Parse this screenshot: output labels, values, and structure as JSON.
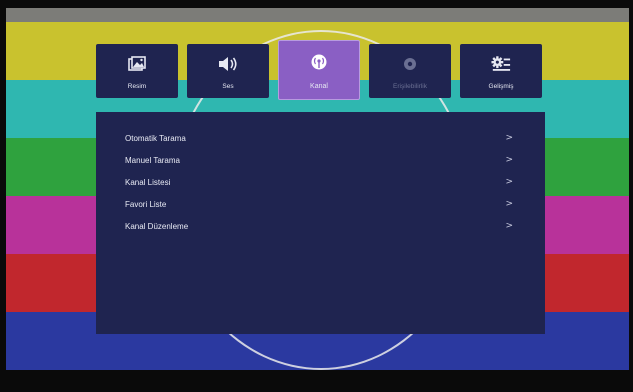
{
  "tabs": [
    {
      "label": "Resim",
      "icon": "picture-icon",
      "active": false,
      "enabled": true
    },
    {
      "label": "Ses",
      "icon": "speaker-icon",
      "active": false,
      "enabled": true
    },
    {
      "label": "Kanal",
      "icon": "antenna-icon",
      "active": true,
      "enabled": true
    },
    {
      "label": "Erişilebilirlik",
      "icon": "eye-icon",
      "active": false,
      "enabled": false
    },
    {
      "label": "Gelişmiş",
      "icon": "gear-icon",
      "active": false,
      "enabled": true
    }
  ],
  "channel_menu": {
    "items": [
      {
        "label": "Otomatik Tarama",
        "chevron": ">"
      },
      {
        "label": "Manuel Tarama",
        "chevron": ">"
      },
      {
        "label": "Kanal Listesi",
        "chevron": ">"
      },
      {
        "label": "Favori Liste",
        "chevron": ">"
      },
      {
        "label": "Kanal Düzenleme",
        "chevron": ">"
      }
    ]
  },
  "colors": {
    "panel_bg": "#1f2450",
    "active_tab": "#8a5fc4",
    "test_bars": [
      "#c9c22e",
      "#2fb7b0",
      "#2fa23e",
      "#b8329a",
      "#c1272d",
      "#2b39a0"
    ]
  }
}
